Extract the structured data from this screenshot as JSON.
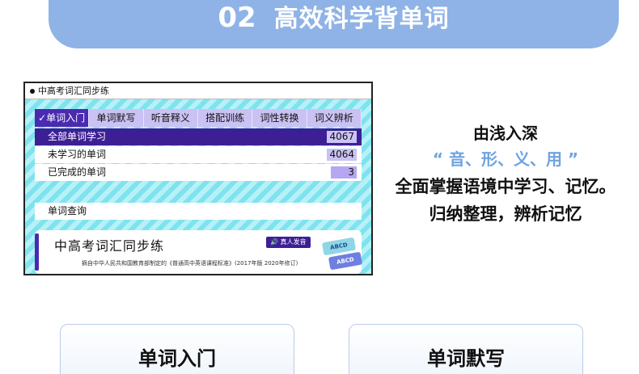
{
  "banner": {
    "number": "02",
    "title": "高效科学背单词"
  },
  "app": {
    "window_title": "中高考词汇同步练",
    "tabs": [
      {
        "label": "✓单词入门",
        "active": true
      },
      {
        "label": "单词默写"
      },
      {
        "label": "听音释义"
      },
      {
        "label": "搭配训练"
      },
      {
        "label": "词性转换"
      },
      {
        "label": "词义辨析"
      }
    ],
    "rows": [
      {
        "label": "全部单词学习",
        "count": "4067"
      },
      {
        "label": "未学习的单词",
        "count": "4064"
      },
      {
        "label": "已完成的单词",
        "count": "3"
      }
    ],
    "lookup_label": "单词查询",
    "card": {
      "title": "中高考词汇同步练",
      "voice_label": "🔊 真人发音",
      "description": "摘自中华人民共和国教育部制定的《普通高中英语课程标准》(2017年版 2020年修订)",
      "tag1": "ABCD",
      "tag2": "ABCD"
    }
  },
  "slogan": {
    "line1": "由浅入深",
    "line2": "“ 音、形、义、用 ”",
    "line3": "全面掌握语境中学习、记忆。",
    "line4": "归纳整理，辨析记忆"
  },
  "buttons": {
    "first": "单词入门",
    "second": "单词默写"
  },
  "colors": {
    "accent": "#4a2ab0",
    "banner": "#8fb3e6",
    "stripe": "#7fe3ee",
    "slogan_highlight": "#6fa3e0"
  }
}
